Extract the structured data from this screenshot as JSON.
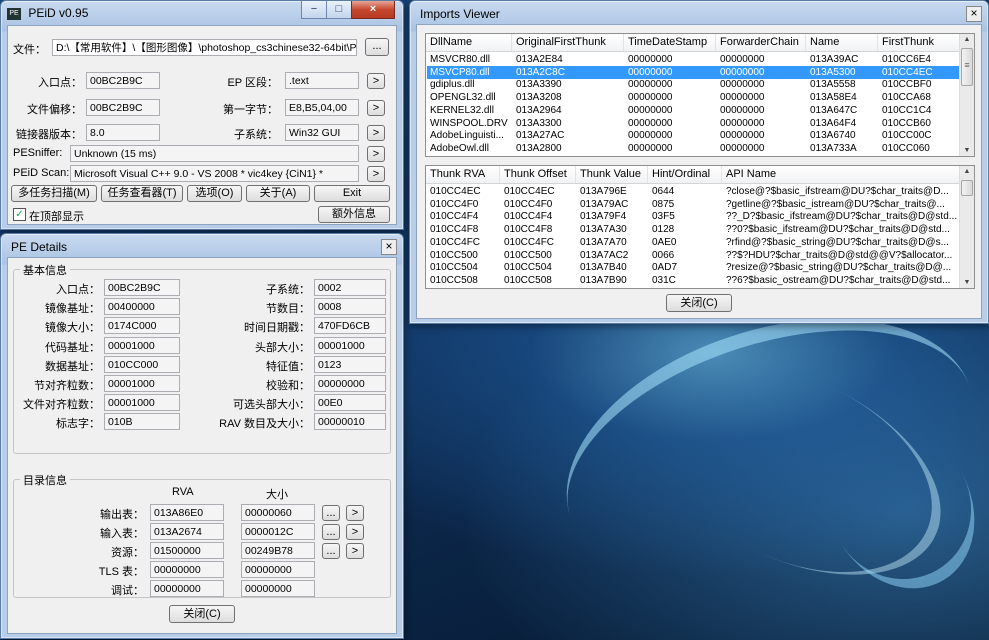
{
  "peid": {
    "title": "PEiD v0.95",
    "file_label": "文件：",
    "file_path": "D:\\【常用软件】\\【图形图像】\\photoshop_cs3chinese32-64bit\\P",
    "browse_label": "...",
    "fields": [
      {
        "label": "入口点：",
        "value": "00BC2B9C"
      },
      {
        "label": "文件偏移：",
        "value": "00BC2B9C"
      },
      {
        "label": "链接器版本：",
        "value": "8.0"
      }
    ],
    "fields_right": [
      {
        "label": "EP 区段：",
        "value": ".text"
      },
      {
        "label": "第一字节：",
        "value": "E8,B5,04,00"
      },
      {
        "label": "子系统：",
        "value": "Win32 GUI"
      }
    ],
    "pesniffer_label": "PESniffer:",
    "pesniffer_value": "Unknown (15 ms)",
    "scan_label": "PEiD Scan:",
    "scan_value": "Microsoft Visual C++ 9.0 - VS 2008 * vic4key {CiN1} *",
    "buttons": [
      "多任务扫描(M)",
      "任务查看器(T)",
      "选项(O)",
      "关于(A)",
      "Exit"
    ],
    "ontop_label": "在顶部显示",
    "extra_label": "额外信息",
    "arrow": ">"
  },
  "pe_details": {
    "title": "PE Details",
    "basic_title": "基本信息",
    "left": [
      {
        "label": "入口点：",
        "value": "00BC2B9C"
      },
      {
        "label": "镜像基址：",
        "value": "00400000"
      },
      {
        "label": "镜像大小：",
        "value": "0174C000"
      },
      {
        "label": "代码基址：",
        "value": "00001000"
      },
      {
        "label": "数据基址：",
        "value": "010CC000"
      },
      {
        "label": "节对齐粒数：",
        "value": "00001000"
      },
      {
        "label": "文件对齐粒数：",
        "value": "00001000"
      },
      {
        "label": "标志字：",
        "value": "010B"
      }
    ],
    "right": [
      {
        "label": "子系统：",
        "value": "0002"
      },
      {
        "label": "节数目：",
        "value": "0008"
      },
      {
        "label": "时间日期戳：",
        "value": "470FD6CB"
      },
      {
        "label": "头部大小：",
        "value": "00001000"
      },
      {
        "label": "特征值：",
        "value": "0123"
      },
      {
        "label": "校验和：",
        "value": "00000000"
      },
      {
        "label": "可选头部大小：",
        "value": "00E0"
      },
      {
        "label": "RAV 数目及大小：",
        "value": "00000010"
      }
    ],
    "dir_title": "目录信息",
    "col_rva": "RVA",
    "col_size": "大小",
    "dirs": [
      {
        "label": "输出表：",
        "rva": "013A86E0",
        "size": "00000060",
        "buttons": true
      },
      {
        "label": "输入表：",
        "rva": "013A2674",
        "size": "0000012C",
        "buttons": true
      },
      {
        "label": "资源：",
        "rva": "01500000",
        "size": "00249B78",
        "buttons": true
      },
      {
        "label": "TLS 表：",
        "rva": "00000000",
        "size": "00000000",
        "buttons": false
      },
      {
        "label": "调试：",
        "rva": "00000000",
        "size": "00000000",
        "buttons": false
      }
    ],
    "dots": "...",
    "arrow": ">",
    "close_label": "关闭(C)",
    "x": "×"
  },
  "imports": {
    "title": "Imports Viewer",
    "dll_cols": [
      "DllName",
      "OriginalFirstThunk",
      "TimeDateStamp",
      "ForwarderChain",
      "Name",
      "FirstThunk"
    ],
    "dll_rows": [
      [
        "MSVCR80.dll",
        "013A2E84",
        "00000000",
        "00000000",
        "013A39AC",
        "010CC6E4"
      ],
      [
        "MSVCP80.dll",
        "013A2C8C",
        "00000000",
        "00000000",
        "013A5300",
        "010CC4EC"
      ],
      [
        "gdiplus.dll",
        "013A3390",
        "00000000",
        "00000000",
        "013A5558",
        "010CCBF0"
      ],
      [
        "OPENGL32.dll",
        "013A3208",
        "00000000",
        "00000000",
        "013A58E4",
        "010CCA68"
      ],
      [
        "KERNEL32.dll",
        "013A2964",
        "00000000",
        "00000000",
        "013A647C",
        "010CC1C4"
      ],
      [
        "WINSPOOL.DRV",
        "013A3300",
        "00000000",
        "00000000",
        "013A64F4",
        "010CCB60"
      ],
      [
        "AdobeLinguisti...",
        "013A27AC",
        "00000000",
        "00000000",
        "013A6740",
        "010CC00C"
      ],
      [
        "AdobeOwl.dll",
        "013A2800",
        "00000000",
        "00000000",
        "013A733A",
        "010CC060"
      ]
    ],
    "selected_dll": 1,
    "thunk_cols": [
      "Thunk RVA",
      "Thunk Offset",
      "Thunk Value",
      "Hint/Ordinal",
      "API Name"
    ],
    "thunk_rows": [
      [
        "010CC4EC",
        "010CC4EC",
        "013A796E",
        "0644",
        "?close@?$basic_ifstream@DU?$char_traits@D..."
      ],
      [
        "010CC4F0",
        "010CC4F0",
        "013A79AC",
        "0875",
        "?getline@?$basic_istream@DU?$char_traits@..."
      ],
      [
        "010CC4F4",
        "010CC4F4",
        "013A79F4",
        "03F5",
        "??_D?$basic_ifstream@DU?$char_traits@D@std..."
      ],
      [
        "010CC4F8",
        "010CC4F8",
        "013A7A30",
        "0128",
        "??0?$basic_ifstream@DU?$char_traits@D@std..."
      ],
      [
        "010CC4FC",
        "010CC4FC",
        "013A7A70",
        "0AE0",
        "?rfind@?$basic_string@DU?$char_traits@D@s..."
      ],
      [
        "010CC500",
        "010CC500",
        "013A7AC2",
        "0066",
        "??$?HDU?$char_traits@D@std@@V?$allocator..."
      ],
      [
        "010CC504",
        "010CC504",
        "013A7B40",
        "0AD7",
        "?resize@?$basic_string@DU?$char_traits@D@..."
      ],
      [
        "010CC508",
        "010CC508",
        "013A7B90",
        "031C",
        "??6?$basic_ostream@DU?$char_traits@D@std..."
      ]
    ],
    "close_label": "关闭(C)",
    "x": "×"
  },
  "window_buttons": {
    "minimize": "−",
    "maximize": "□",
    "close": "×"
  },
  "icons": {
    "check": "✓",
    "up": "▲",
    "down": "▼",
    "grip": "≡"
  }
}
